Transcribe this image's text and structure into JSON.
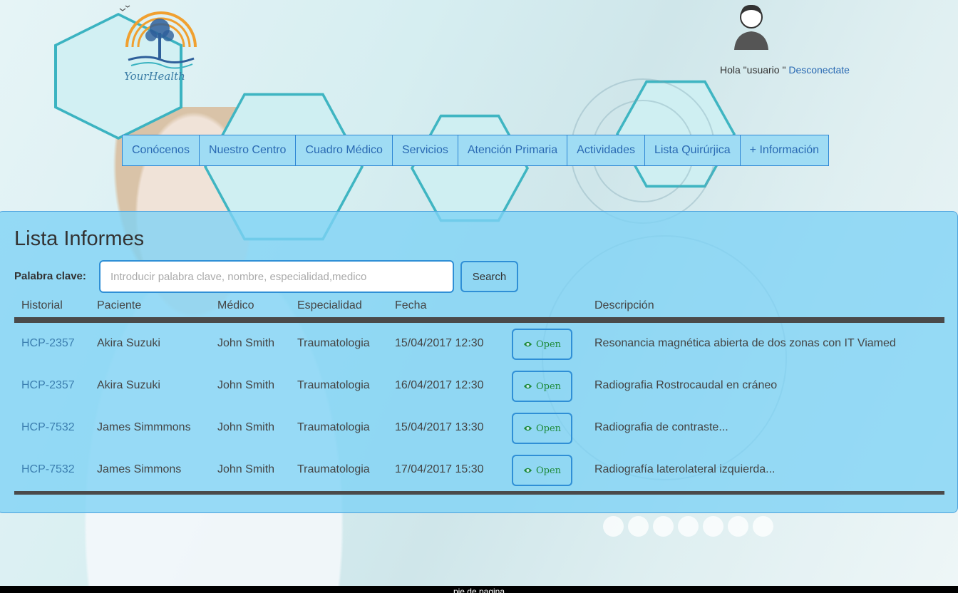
{
  "brand": {
    "logo_text": "YourHealth"
  },
  "user": {
    "greeting": "Hola \"usuario \"",
    "logout_label": "Desconectate"
  },
  "nav": {
    "items": [
      {
        "label": "Conócenos"
      },
      {
        "label": "Nuestro Centro"
      },
      {
        "label": "Cuadro Médico"
      },
      {
        "label": "Servicios"
      },
      {
        "label": "Atención Primaria"
      },
      {
        "label": "Actividades"
      },
      {
        "label": "Lista Quirúrjica"
      },
      {
        "label": "+ Información"
      }
    ]
  },
  "main": {
    "title": "Lista Informes",
    "search": {
      "label": "Palabra clave:",
      "placeholder": "Introducir palabra clave, nombre, especialidad,medico",
      "value": "",
      "button_label": "Search"
    },
    "table": {
      "columns": [
        "Historial",
        "Paciente",
        "Médico",
        "Especialidad",
        "Fecha",
        "Descripción"
      ],
      "open_label": "Open",
      "rows": [
        {
          "historial": "HCP-2357",
          "paciente": "Akira Suzuki",
          "medico": "John Smith",
          "especialidad": "Traumatologia",
          "fecha": "15/04/2017 12:30",
          "descripcion": "Resonancia magnética abierta de dos zonas con IT Viamed"
        },
        {
          "historial": "HCP-2357",
          "paciente": "Akira Suzuki",
          "medico": "John Smith",
          "especialidad": "Traumatologia",
          "fecha": "16/04/2017 12:30",
          "descripcion": "Radiografia Rostrocaudal en cráneo"
        },
        {
          "historial": "HCP-7532",
          "paciente": "James Simmmons",
          "medico": "John Smith",
          "especialidad": "Traumatologia",
          "fecha": "15/04/2017 13:30",
          "descripcion": "Radiografia de contraste..."
        },
        {
          "historial": "HCP-7532",
          "paciente": "James Simmons",
          "medico": "John Smith",
          "especialidad": "Traumatologia",
          "fecha": "17/04/2017 15:30",
          "descripcion": "Radiografía laterolateral izquierda..."
        }
      ]
    }
  },
  "footer": {
    "text": "pie de pagina"
  },
  "colors": {
    "panel": "#7ed2f5",
    "nav_bg": "#9fdcf4",
    "border_accent": "#2f8fd6",
    "link": "#2a6ab3",
    "open_text": "#1e8a3a"
  },
  "icons": {
    "open": "eye-icon",
    "avatar": "user-avatar-icon",
    "logo": "tree-logo-icon"
  }
}
